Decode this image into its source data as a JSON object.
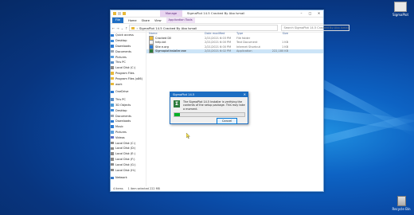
{
  "desktop": {
    "top_icon_label": "SigmaPlot",
    "recycle_bin_label": "Recycle Bin"
  },
  "explorer": {
    "manage_tab": "Manage",
    "title": "SigmaPlot 14.5 Cracked By Abo Ismail",
    "ribbon_tabs": [
      "File",
      "Home",
      "Share",
      "View",
      "Application Tools"
    ],
    "address_path": "SigmaPlot 14.5 Cracked By Abo Ismail",
    "search_placeholder": "Search SigmaPlot 14.5 Cracked By Abo Ismail",
    "columns": {
      "name": "Name",
      "date": "Date modified",
      "type": "Type",
      "size": "Size"
    },
    "files": [
      {
        "name": "Cracked Dll",
        "date": "2/21/2021 6:03 PM",
        "type": "File folder",
        "size": "",
        "icon": "folder-icon"
      },
      {
        "name": "help.txt",
        "date": "2/21/2021 6:00 PM",
        "type": "Text Document",
        "size": "1 KB",
        "icon": "text-file-icon"
      },
      {
        "name": "Site e.org",
        "date": "2/21/2021 6:00 PM",
        "type": "Internet Shortcut",
        "size": "1 KB",
        "icon": "shortcut-icon"
      },
      {
        "name": "SigmaplotInstaller.exe",
        "date": "2/21/2021 6:02 PM",
        "type": "Application",
        "size": "222,180 KB",
        "icon": "installer-icon"
      }
    ],
    "nav": [
      {
        "label": "Quick access",
        "icon": "star-icon"
      },
      {
        "label": "Desktop",
        "icon": "desktop-icon"
      },
      {
        "label": "Downloads",
        "icon": "download-icon"
      },
      {
        "label": "Documents",
        "icon": "document-icon"
      },
      {
        "label": "Pictures",
        "icon": "picture-icon"
      },
      {
        "label": "This PC",
        "icon": "computer-icon"
      },
      {
        "label": "Local Disk (C:)",
        "icon": "drive-icon"
      },
      {
        "label": "Program Files",
        "icon": "folder-icon"
      },
      {
        "label": "Program Files (x86)",
        "icon": "folder-icon"
      },
      {
        "label": "work",
        "icon": "folder-icon"
      },
      {
        "label": "",
        "icon": "spacer"
      },
      {
        "label": "OneDrive",
        "icon": "cloud-icon"
      },
      {
        "label": "",
        "icon": "spacer"
      },
      {
        "label": "This PC",
        "icon": "computer-icon"
      },
      {
        "label": "3D Objects",
        "icon": "cube-icon"
      },
      {
        "label": "Desktop",
        "icon": "desktop-icon"
      },
      {
        "label": "Documents",
        "icon": "document-icon"
      },
      {
        "label": "Downloads",
        "icon": "download-icon"
      },
      {
        "label": "Music",
        "icon": "music-icon"
      },
      {
        "label": "Pictures",
        "icon": "picture-icon"
      },
      {
        "label": "Videos",
        "icon": "video-icon"
      },
      {
        "label": "Local Disk (C:)",
        "icon": "drive-icon"
      },
      {
        "label": "Local Disk (D:)",
        "icon": "drive-icon"
      },
      {
        "label": "Local Disk (E:)",
        "icon": "drive-icon"
      },
      {
        "label": "Local Disk (F:)",
        "icon": "drive-icon"
      },
      {
        "label": "Local Disk (G:)",
        "icon": "drive-icon"
      },
      {
        "label": "Local Disk (H:)",
        "icon": "drive-icon"
      },
      {
        "label": "",
        "icon": "spacer"
      },
      {
        "label": "Network",
        "icon": "network-icon"
      }
    ],
    "status": {
      "items": "4 items",
      "selected": "1 item selected 222 MB"
    }
  },
  "dialog": {
    "title": "SigmaPlot 14.5",
    "message": "The SigmaPlot 14.5 Installer is verifying the contents of the setup package. This may take a moment.",
    "progress": 0.08,
    "cancel_label": "Cancel"
  },
  "colors": {
    "accent": "#1c6ec2",
    "progress": "#06b025",
    "selection": "#cce4f7"
  }
}
